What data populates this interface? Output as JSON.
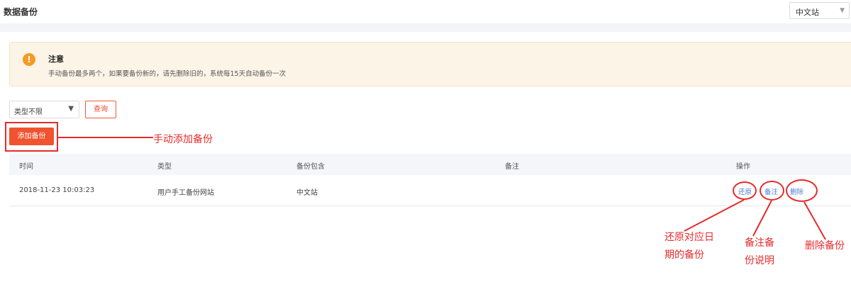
{
  "header": {
    "title": "数据备份",
    "site_select_value": "中文站"
  },
  "notice": {
    "icon": "exclamation-icon",
    "icon_glyph": "!",
    "title": "注意",
    "text": "手动备份最多两个，如果要备份新的，请先删除旧的，系统每15天自动备份一次"
  },
  "filter": {
    "type_select_value": "类型不限",
    "query_label": "查询"
  },
  "toolbar": {
    "add_label": "添加备份"
  },
  "table": {
    "columns": [
      "时间",
      "类型",
      "备份包含",
      "备注",
      "操作"
    ],
    "rows": [
      {
        "time": "2018-11-23 10:03:23",
        "type": "用户手工备份网站",
        "includes": "中文站",
        "note": "",
        "actions": [
          "还原",
          "备注",
          "删除"
        ]
      }
    ]
  },
  "annotations": {
    "add": "手动添加备份",
    "restore_line1": "还原对应日",
    "restore_line2": "期的备份",
    "note_line1": "备注备",
    "note_line2": "份说明",
    "delete": "删除备份"
  },
  "colors": {
    "accent": "#f0532f",
    "annotation_red": "#e52b2b",
    "link_blue": "#4a7bd6",
    "notice_bg": "#fdf4e8",
    "warning_icon": "#f59a23"
  }
}
